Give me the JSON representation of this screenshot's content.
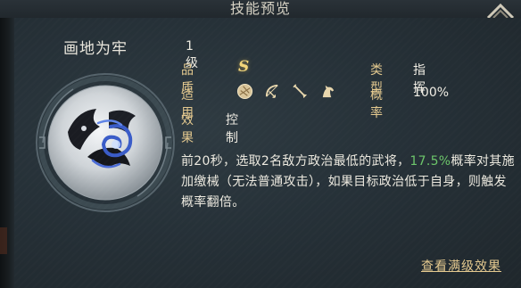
{
  "header": {
    "title": "技能预览"
  },
  "skill": {
    "name": "画地为牢",
    "level": "1级",
    "quality_label": "品质",
    "quality_value": "S",
    "type_label": "类型",
    "type_value": "指挥",
    "suit_label": "适用",
    "suit_icons": [
      "shield-icon",
      "bow-icon",
      "spear-icon",
      "horse-icon"
    ],
    "rate_label": "概率",
    "rate_value": "100%",
    "effect_label": "效果",
    "effect_value": "控制",
    "description": {
      "part1": "前20秒，选取2名敌方政治最低的武将，",
      "highlight": "17.5%",
      "part2": "概率对其施加缴械（无法普通攻击），如果目标政治低于自身，则触发概率翻倍。"
    }
  },
  "footer": {
    "view_full_label": "查看满级效果"
  },
  "colors": {
    "gold_label": "#e4c98f",
    "highlight_green": "#6cc56a",
    "quality_gold": "#f2d67a"
  }
}
